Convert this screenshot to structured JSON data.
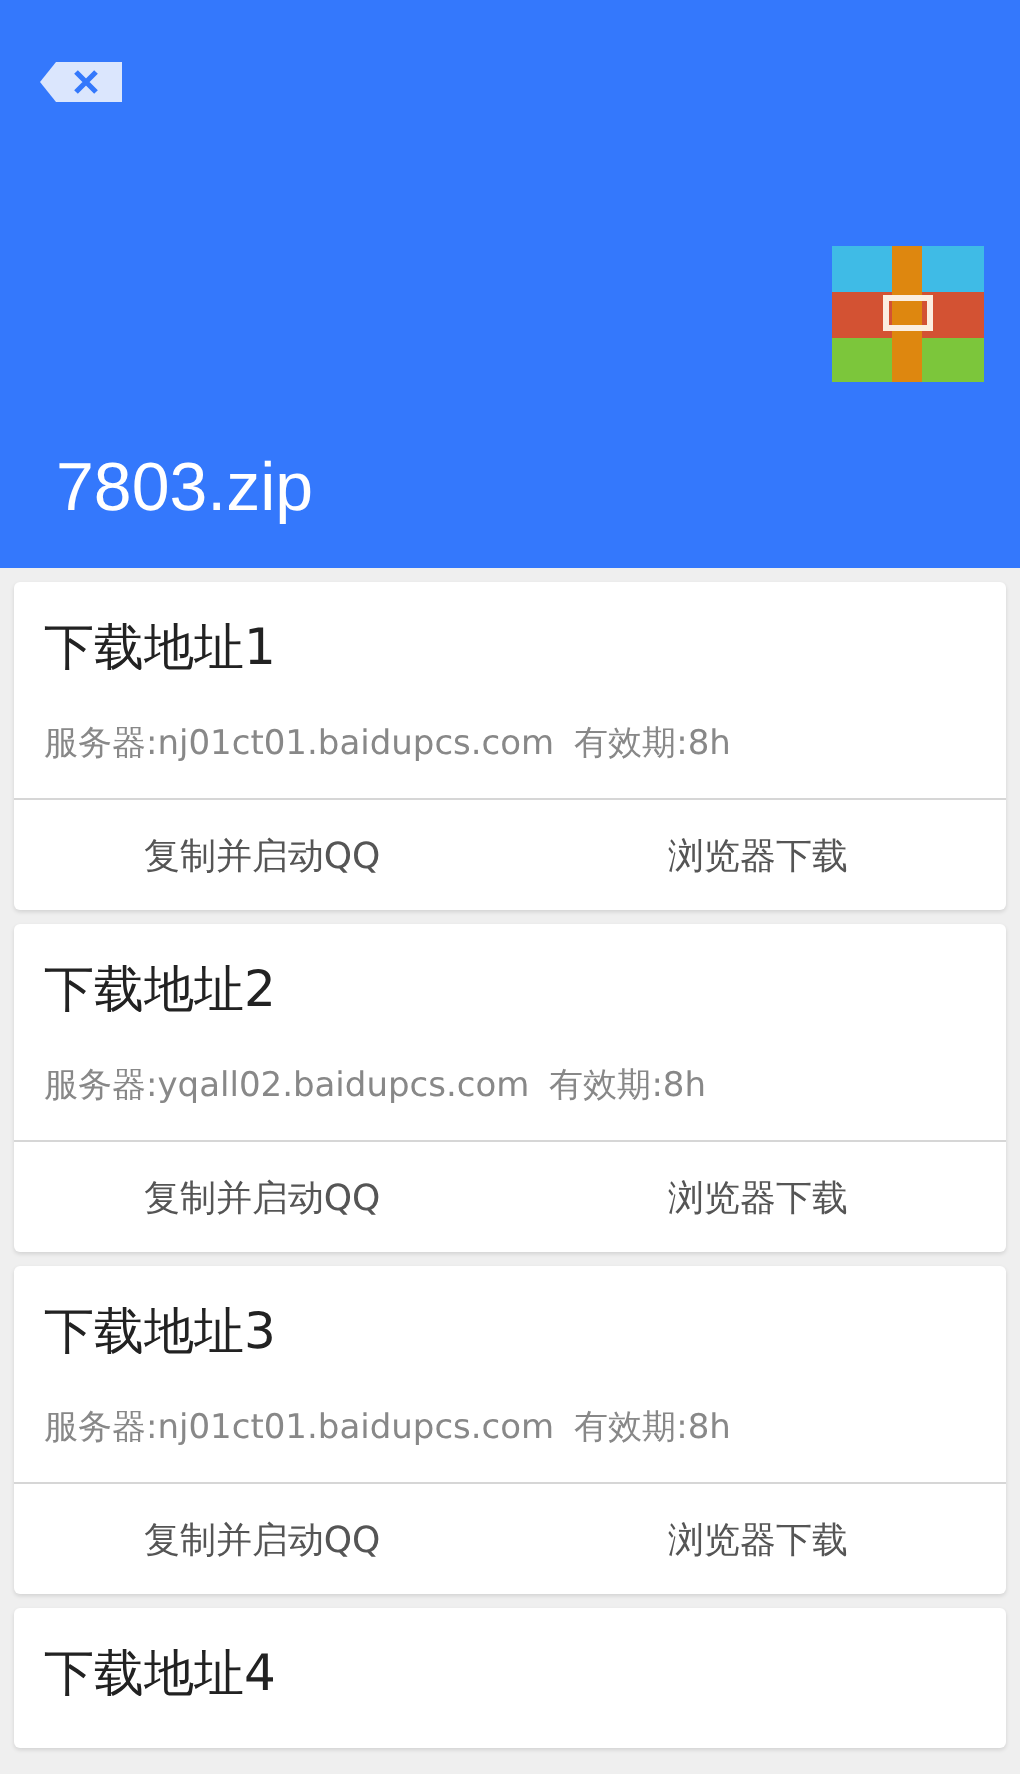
{
  "header": {
    "title": "7803.zip"
  },
  "links": [
    {
      "title": "下载地址1",
      "server": "服务器:nj01ct01.baidupcs.com",
      "expiry": "有效期:8h",
      "buttons": [
        "复制并启动QQ",
        "浏览器下载"
      ]
    },
    {
      "title": "下载地址2",
      "server": "服务器:yqall02.baidupcs.com",
      "expiry": "有效期:8h",
      "buttons": [
        "复制并启动QQ",
        "浏览器下载"
      ]
    },
    {
      "title": "下载地址3",
      "server": "服务器:nj01ct01.baidupcs.com",
      "expiry": "有效期:8h",
      "buttons": [
        "复制并启动QQ",
        "浏览器下载"
      ]
    },
    {
      "title": "下载地址4"
    }
  ]
}
